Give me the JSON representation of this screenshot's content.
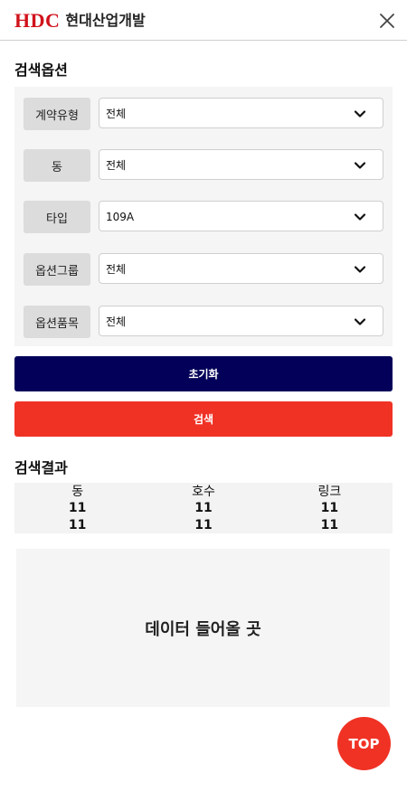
{
  "header": {
    "logo_mark": "HDC",
    "logo_text": "현대산업개발",
    "brand_color": "#d0121b",
    "close_icon": "close-icon"
  },
  "search_options": {
    "title": "검색옵션",
    "rows": [
      {
        "label": "계약유형",
        "value": "전체"
      },
      {
        "label": "동",
        "value": "전체"
      },
      {
        "label": "타입",
        "value": "109A"
      },
      {
        "label": "옵션그룹",
        "value": "전체"
      },
      {
        "label": "옵션품목",
        "value": "전체"
      }
    ],
    "reset_label": "초기화",
    "search_label": "검색",
    "reset_color": "#020058",
    "search_color": "#f03225"
  },
  "results": {
    "title": "검색결과",
    "columns": [
      "동",
      "호수",
      "링크"
    ],
    "rows": [
      [
        "11",
        "11",
        "11"
      ],
      [
        "11",
        "11",
        "11"
      ]
    ],
    "placeholder": "데이터 들어올 곳"
  },
  "top_button": {
    "label": "TOP",
    "color": "#f03225"
  }
}
